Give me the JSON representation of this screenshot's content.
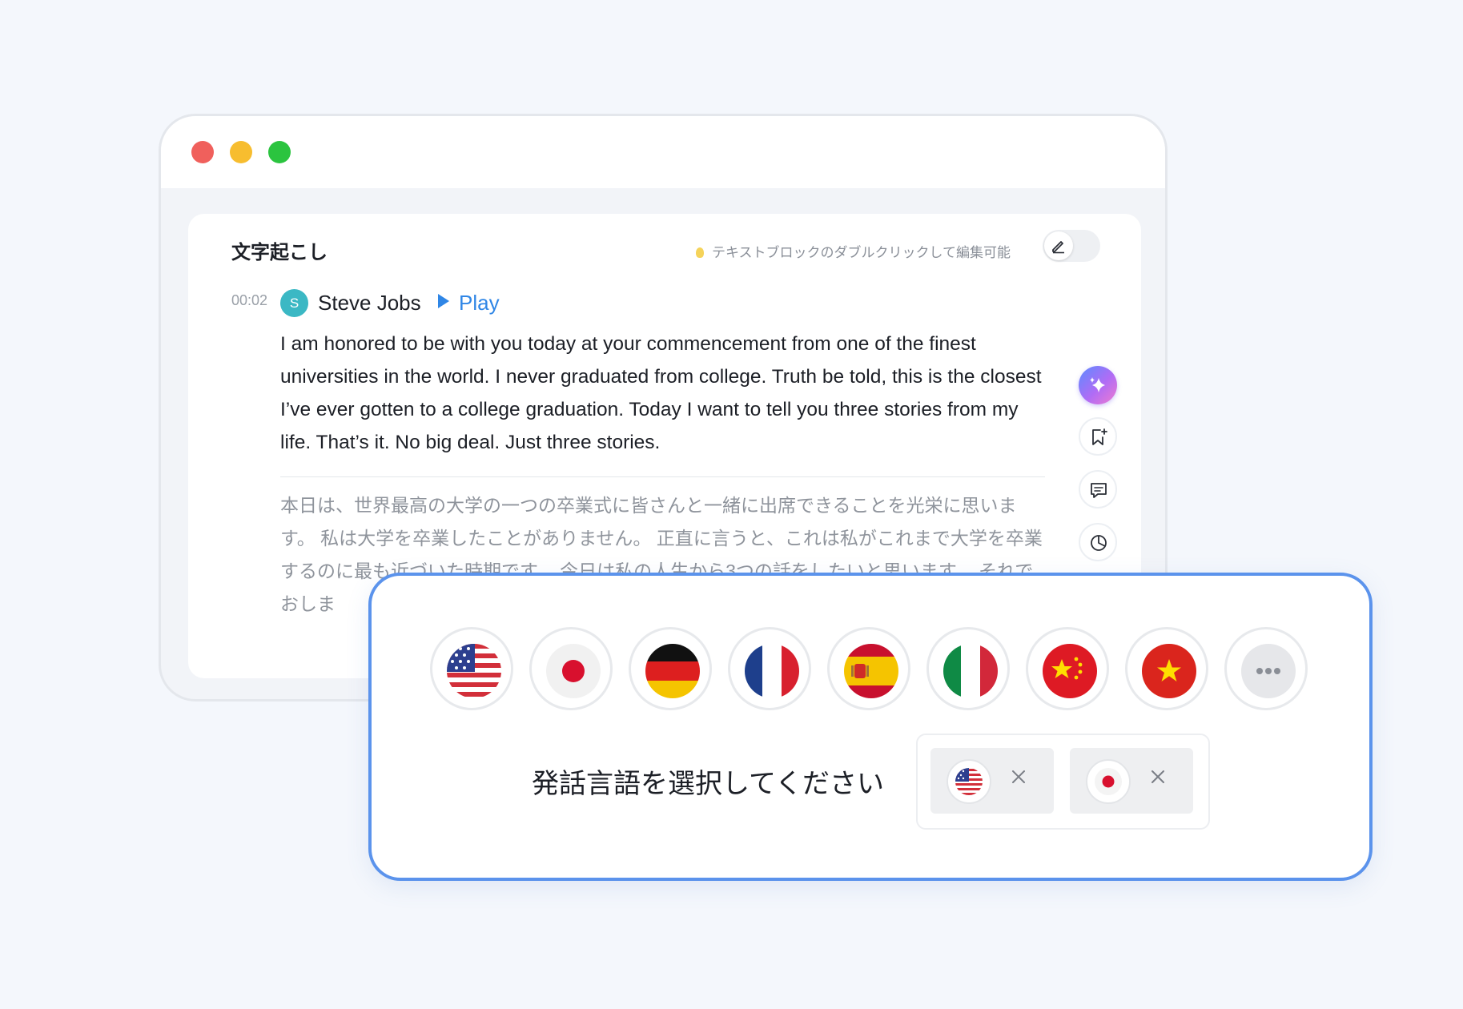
{
  "window": {
    "traffic_lights": [
      "close",
      "minimize",
      "zoom"
    ]
  },
  "transcript": {
    "title": "文字起こし",
    "hint": "テキストブロックのダブルクリックして編集可能",
    "entry": {
      "timestamp": "00:02",
      "avatar_initial": "S",
      "speaker": "Steve Jobs",
      "play_label": "Play",
      "english": "I am honored to be with you today at your commencement from one of the finest universities in the world. I never graduated from college. Truth be told, this is the closest I’ve ever gotten to a college graduation. Today I want to tell you three stories from my life. That’s it. No big deal. Just three stories.",
      "japanese": "本日は、世界最高の大学の一つの卒業式に皆さんと一緒に出席できることを光栄に思います。 私は大学を卒業したことがありません。 正直に言うと、これは私がこれまで大学を卒業するのに最も近づいた時期です。 今日は私の人生から3つの話をしたいと思います。 それでおしま"
    },
    "side_actions": [
      "ai-sparkle-icon",
      "bookmark-add-icon",
      "comment-icon",
      "pie-chart-icon"
    ]
  },
  "language_selector": {
    "flags": [
      "us-flag-icon",
      "japan-flag-icon",
      "germany-flag-icon",
      "france-flag-icon",
      "spain-flag-icon",
      "italy-flag-icon",
      "china-flag-icon",
      "vietnam-flag-icon",
      "more-icon"
    ],
    "prompt": "発話言語を選択してください",
    "selected": [
      "us-flag-icon",
      "japan-flag-icon"
    ]
  },
  "colors": {
    "accent": "#2f86e6",
    "panel_border": "#5b93ec",
    "avatar": "#3bb8c4"
  }
}
